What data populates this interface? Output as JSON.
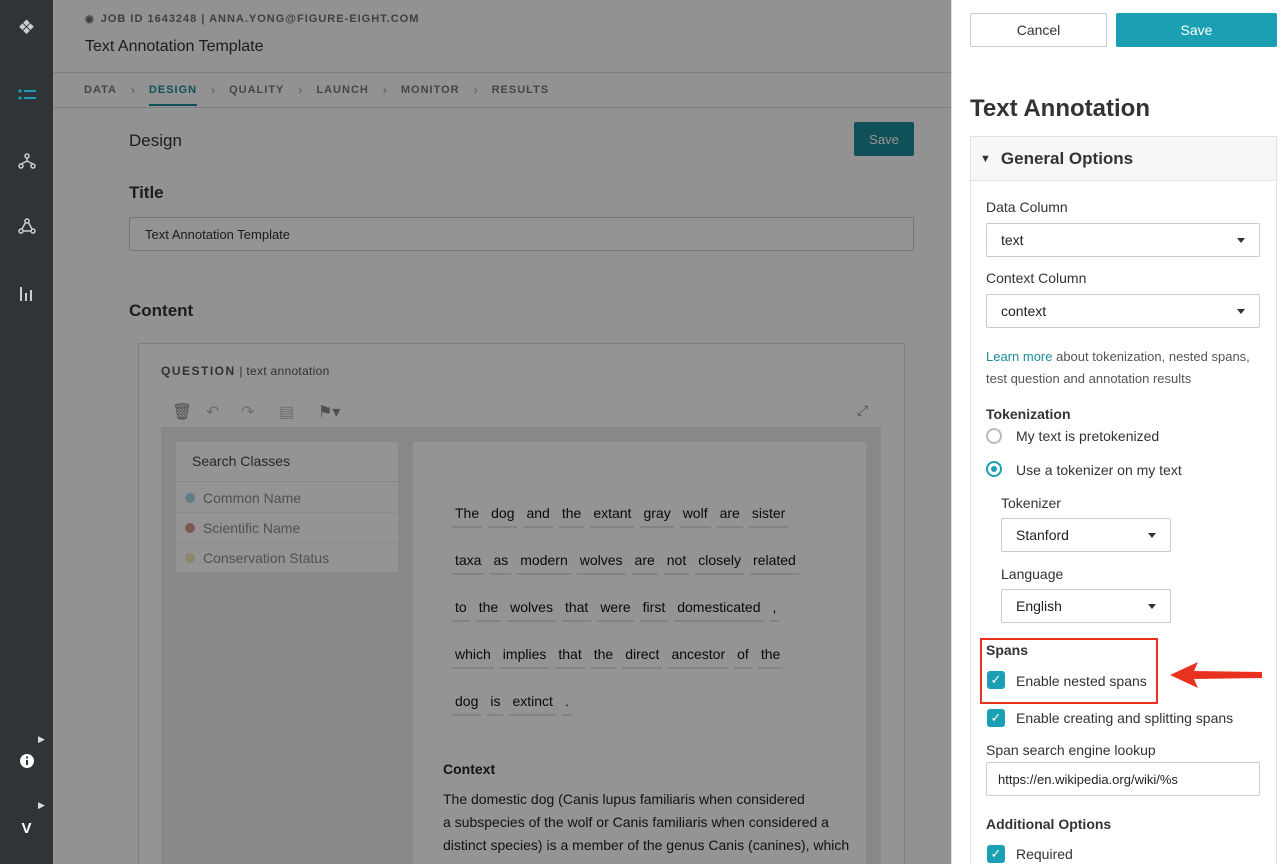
{
  "job": {
    "id_line": "JOB ID 1643248 | ANNA.YONG@FIGURE-EIGHT.COM",
    "title": "Text Annotation Template"
  },
  "steps": [
    "DATA",
    "DESIGN",
    "QUALITY",
    "LAUNCH",
    "MONITOR",
    "RESULTS"
  ],
  "active_step": "DESIGN",
  "design": {
    "heading": "Design",
    "save_label": "Save",
    "title_label": "Title",
    "title_value": "Text Annotation Template",
    "content_label": "Content"
  },
  "question": {
    "label_prefix": "QUESTION",
    "label_suffix": "| text annotation",
    "search_placeholder": "Search Classes",
    "classes": [
      {
        "name": "Common Name",
        "color": "#a9d8e8"
      },
      {
        "name": "Scientific Name",
        "color": "#d49a94"
      },
      {
        "name": "Conservation Status",
        "color": "#f5e3b6"
      }
    ],
    "token_lines": [
      [
        "The",
        "dog",
        "and",
        "the",
        "extant",
        "gray",
        "wolf",
        "are",
        "sister"
      ],
      [
        "taxa",
        "as",
        "modern",
        "wolves",
        "are",
        "not",
        "closely",
        "related"
      ],
      [
        "to",
        "the",
        "wolves",
        "that",
        "were",
        "first",
        "domesticated",
        ","
      ],
      [
        "which",
        "implies",
        "that",
        "the",
        "direct",
        "ancestor",
        "of",
        "the"
      ],
      [
        "dog",
        "is",
        "extinct",
        "."
      ]
    ],
    "context_heading": "Context",
    "context_lines": [
      "The domestic dog (Canis lupus familiaris when considered",
      "a subspecies of the wolf or Canis familiaris when considered a",
      "distinct species) is a member of the genus Canis (canines), which"
    ]
  },
  "panel": {
    "cancel_label": "Cancel",
    "save_label": "Save",
    "title": "Text Annotation",
    "section": "General Options",
    "data_column_label": "Data Column",
    "data_column_value": "text",
    "context_column_label": "Context Column",
    "context_column_value": "context",
    "learn_more_link": "Learn more",
    "learn_more_rest": " about tokenization, nested spans, test question and annotation results",
    "tokenization_label": "Tokenization",
    "radio_pretokenized": "My text is pretokenized",
    "radio_tokenizer": "Use a tokenizer on my text",
    "tokenizer_label": "Tokenizer",
    "tokenizer_value": "Stanford",
    "language_label": "Language",
    "language_value": "English",
    "spans_label": "Spans",
    "nested_spans": "Enable nested spans",
    "creating_splitting": "Enable creating and splitting spans",
    "span_lookup_label": "Span search engine lookup",
    "span_lookup_value": "https://en.wikipedia.org/wiki/%s",
    "additional_label": "Additional Options",
    "required_label": "Required"
  },
  "nav": {
    "user_initial": "V"
  },
  "colors": {
    "accent": "#1b9fb2",
    "highlight": "#e8321f"
  }
}
